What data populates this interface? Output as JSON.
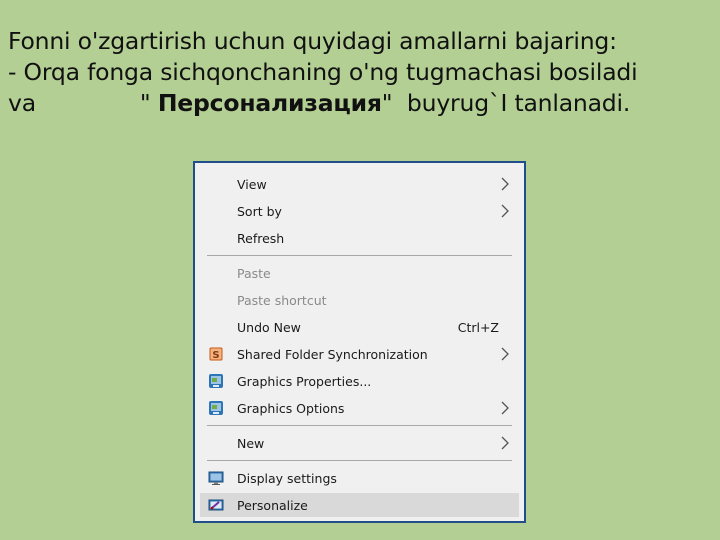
{
  "instructions": {
    "line1": "Fonni o'zgartirish uchun quyidagi amallarni bajaring:",
    "line2": "- Orqa fonga sichqonchaning o'ng tugmachasi bosiladi",
    "line3_prefix": "va",
    "line3_quote_open": "\" ",
    "line3_bold": "Персонализация",
    "line3_quote_close": "\"  buyrug`I tanlanadi."
  },
  "context_menu": {
    "items": [
      {
        "label": "View",
        "submenu": true,
        "icon": null,
        "disabled": false
      },
      {
        "label": "Sort by",
        "submenu": true,
        "icon": null,
        "disabled": false
      },
      {
        "label": "Refresh",
        "submenu": false,
        "icon": null,
        "disabled": false
      },
      {
        "label": "Paste",
        "submenu": false,
        "icon": null,
        "disabled": true
      },
      {
        "label": "Paste shortcut",
        "submenu": false,
        "icon": null,
        "disabled": true
      },
      {
        "label": "Undo New",
        "shortcut": "Ctrl+Z",
        "submenu": false,
        "icon": null,
        "disabled": false
      },
      {
        "label": "Shared Folder Synchronization",
        "submenu": true,
        "icon": "sync-s-icon",
        "disabled": false
      },
      {
        "label": "Graphics Properties...",
        "submenu": false,
        "icon": "graphics-icon",
        "disabled": false
      },
      {
        "label": "Graphics Options",
        "submenu": true,
        "icon": "graphics-icon",
        "disabled": false
      },
      {
        "label": "New",
        "submenu": true,
        "icon": null,
        "disabled": false
      },
      {
        "label": "Display settings",
        "submenu": false,
        "icon": "monitor-icon",
        "disabled": false
      },
      {
        "label": "Personalize",
        "submenu": false,
        "icon": "personalize-icon",
        "disabled": false,
        "highlighted": true
      }
    ]
  },
  "colors": {
    "slide_background": "#b3cf94",
    "menu_background": "#f0f0f0",
    "menu_border": "#1f4e8a",
    "highlight": "#d9d9d9"
  }
}
